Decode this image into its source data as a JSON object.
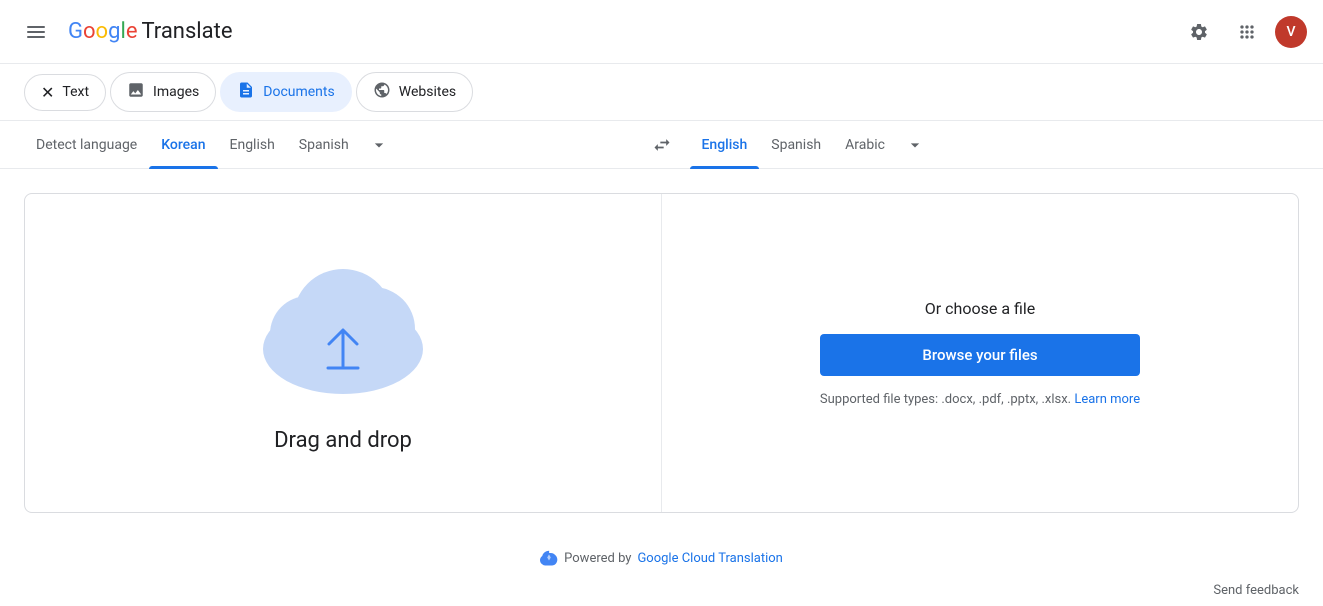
{
  "app": {
    "title": "Google Translate",
    "logo_google": "Google",
    "logo_translate": " Translate"
  },
  "header": {
    "settings_label": "Settings",
    "apps_label": "Google apps",
    "avatar_letter": "V"
  },
  "tabs": [
    {
      "id": "text",
      "label": "Text",
      "icon": "🔤",
      "active": false
    },
    {
      "id": "images",
      "label": "Images",
      "icon": "🖼️",
      "active": false
    },
    {
      "id": "documents",
      "label": "Documents",
      "icon": "📄",
      "active": true
    },
    {
      "id": "websites",
      "label": "Websites",
      "icon": "🌐",
      "active": false
    }
  ],
  "source_languages": [
    {
      "id": "detect",
      "label": "Detect language",
      "active": false
    },
    {
      "id": "korean",
      "label": "Korean",
      "active": true
    },
    {
      "id": "english",
      "label": "English",
      "active": false
    },
    {
      "id": "spanish",
      "label": "Spanish",
      "active": false
    }
  ],
  "target_languages": [
    {
      "id": "english",
      "label": "English",
      "active": true
    },
    {
      "id": "spanish",
      "label": "Spanish",
      "active": false
    },
    {
      "id": "arabic",
      "label": "Arabic",
      "active": false
    }
  ],
  "upload": {
    "drag_label": "Drag and drop",
    "choose_label": "Or choose a file",
    "browse_label": "Browse your files",
    "supported_text": "Supported file types: .docx, .pdf, .pptx, .xlsx.",
    "learn_more_label": "Learn more"
  },
  "powered_by": {
    "text": "Powered by",
    "link_label": "Google Cloud Translation"
  },
  "footer": {
    "send_feedback": "Send feedback"
  }
}
